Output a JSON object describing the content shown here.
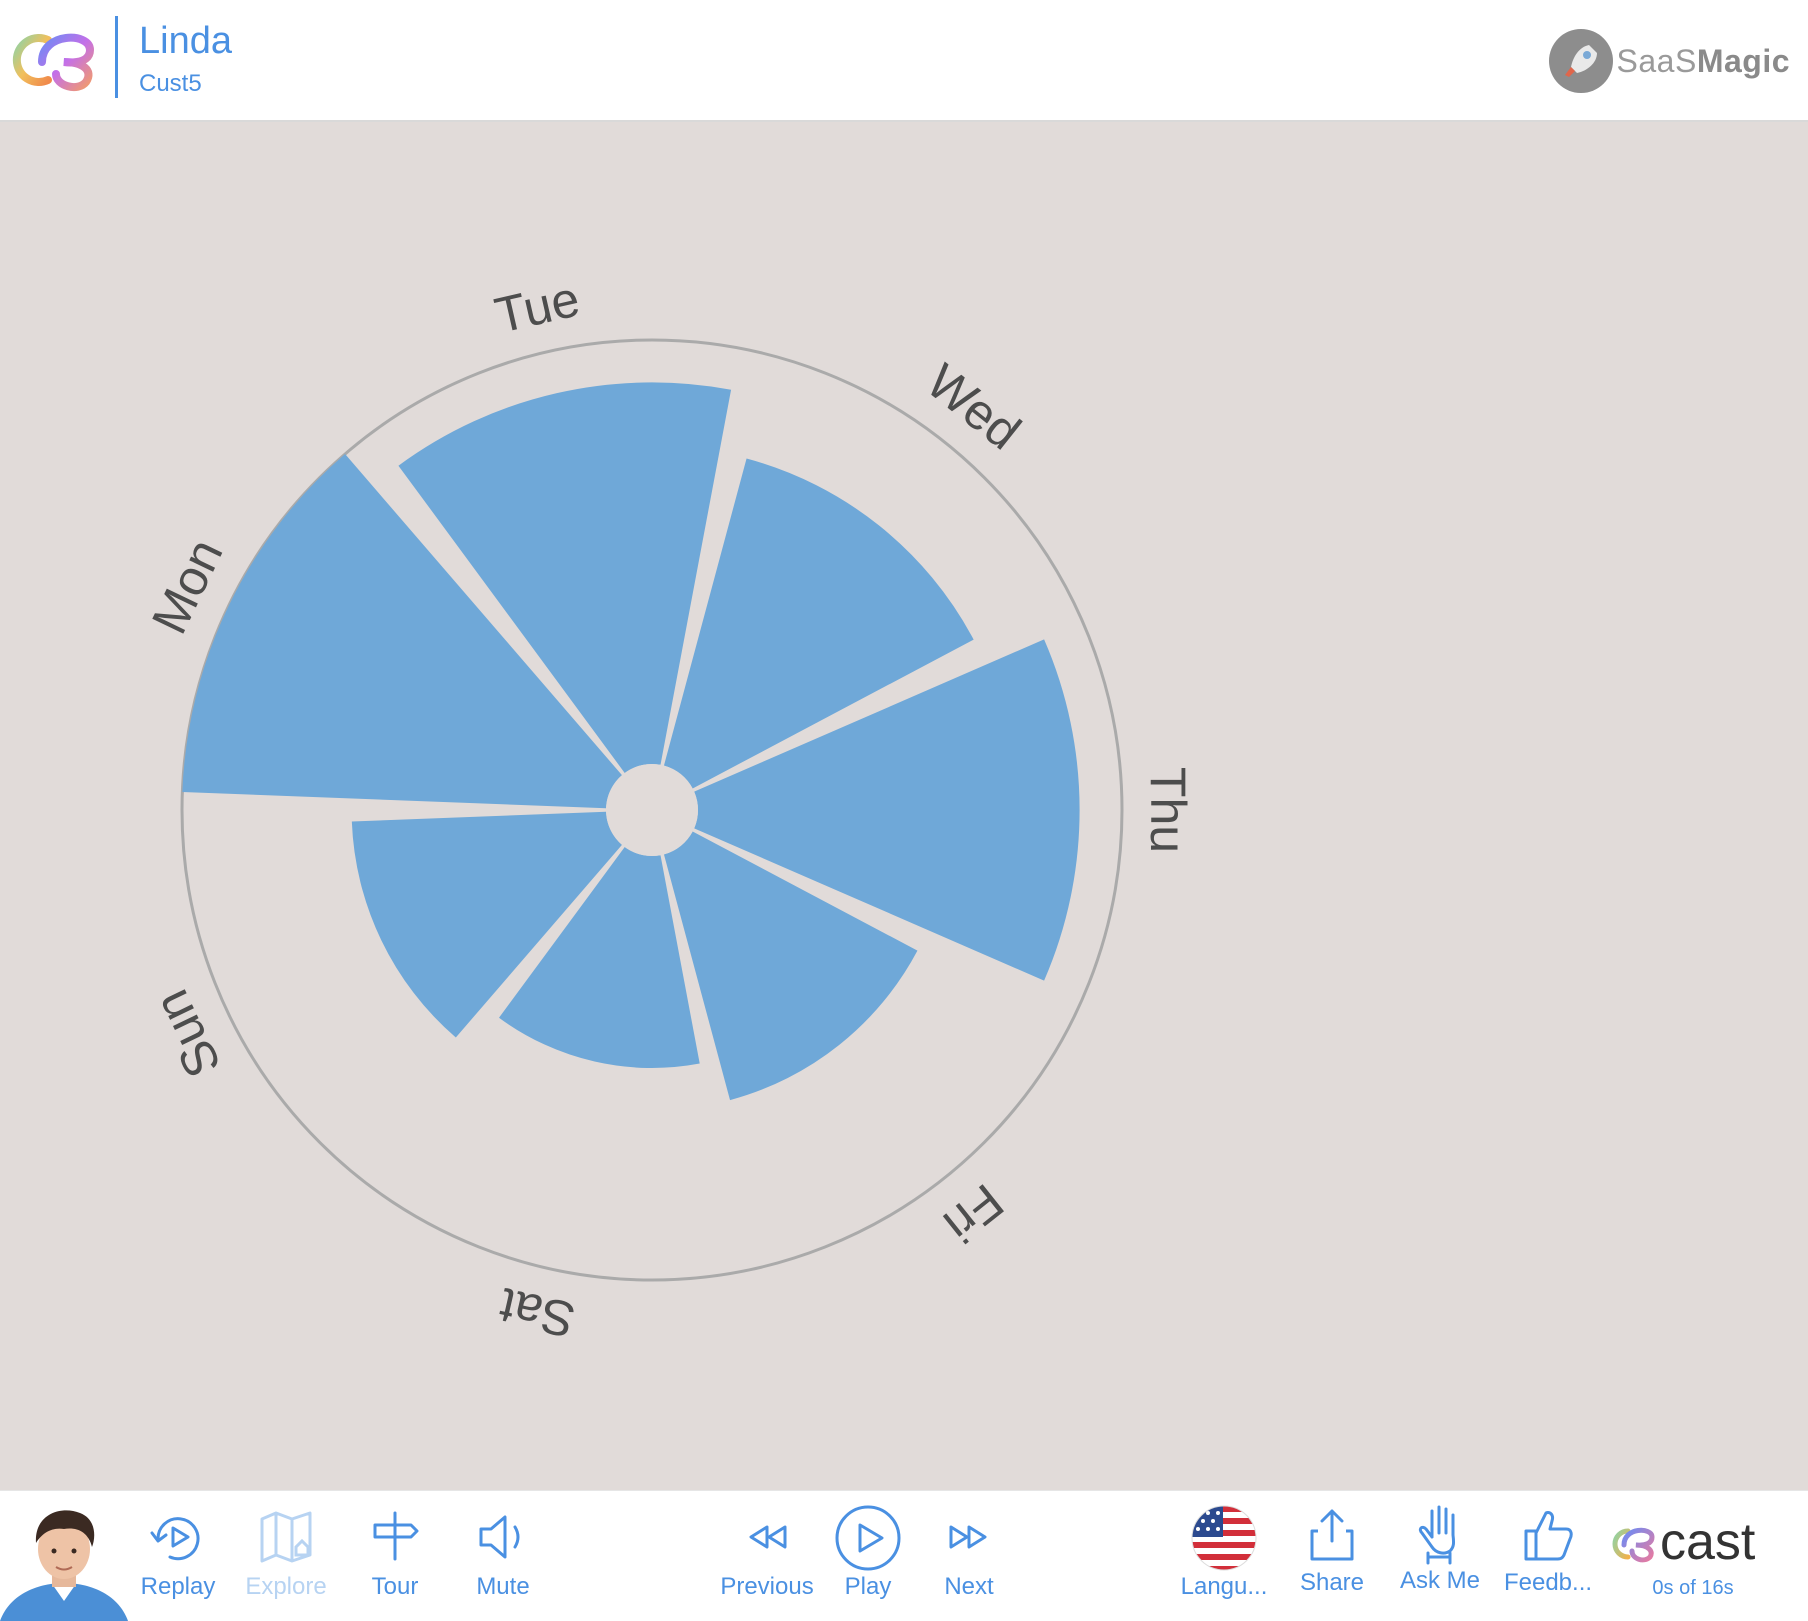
{
  "header": {
    "user_name": "Linda",
    "user_sub": "Cust5",
    "brand_regular": "SaaS",
    "brand_bold": "Magic",
    "logo_icon": "infinity-loop-icon",
    "brand_icon": "rocket-icon"
  },
  "chart_data": {
    "type": "polar-area",
    "categories": [
      "Mon",
      "Tue",
      "Wed",
      "Thu",
      "Fri",
      "Sat",
      "Sun"
    ],
    "values": [
      1.0,
      0.9,
      0.75,
      0.9,
      0.6,
      0.5,
      0.6
    ],
    "rmax": 1.0,
    "bar_color": "#6fa8d8",
    "gridline": "outer circle only",
    "legend": "none"
  },
  "toolbar": {
    "replay": "Replay",
    "explore": "Explore",
    "tour": "Tour",
    "mute": "Mute",
    "previous": "Previous",
    "play": "Play",
    "next": "Next",
    "language": "Langu...",
    "share": "Share",
    "ask_me": "Ask Me",
    "feedback": "Feedb...",
    "cast_brand": "cast",
    "progress": "0s of 16s"
  },
  "colors": {
    "accent": "#4a90e2",
    "accent_disabled": "#b7d3f2",
    "stage_bg": "#e1dbd9",
    "bar": "#6fa8d8"
  }
}
